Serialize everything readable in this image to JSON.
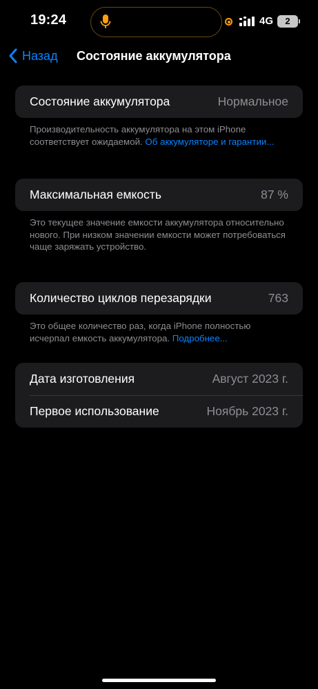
{
  "status_bar": {
    "time": "19:24",
    "network": "4G",
    "battery_level": "2",
    "icons": [
      "microphone-icon",
      "orange-indicator-dot",
      "cellular-signal-icon"
    ]
  },
  "nav": {
    "back_label": "Назад",
    "title": "Состояние аккумулятора"
  },
  "battery_state": {
    "label": "Состояние аккумулятора",
    "value": "Нормальное",
    "footnote_text": "Производительность аккумулятора на этом iPhone соответствует ожидаемой. ",
    "footnote_link": "Об аккумуляторе и гарантии..."
  },
  "max_capacity": {
    "label": "Максимальная емкость",
    "value": "87 %",
    "footnote": "Это текущее значение емкости аккумулятора относительно нового. При низком значении емкости может потребоваться чаще заряжать устройство."
  },
  "cycle_count": {
    "label": "Количество циклов перезарядки",
    "value": "763",
    "footnote_text": "Это общее количество раз, когда iPhone полностью исчерпал емкость аккумулятора. ",
    "footnote_link": "Подробнее..."
  },
  "dates": {
    "manufacture_label": "Дата изготовления",
    "manufacture_value": "Август 2023 г.",
    "first_use_label": "Первое использование",
    "first_use_value": "Ноябрь 2023 г."
  },
  "colors": {
    "background": "#000000",
    "card": "#1c1c1e",
    "accent": "#0a84ff",
    "secondary_text": "#8e8e93",
    "indicator": "#ff9f0a"
  }
}
